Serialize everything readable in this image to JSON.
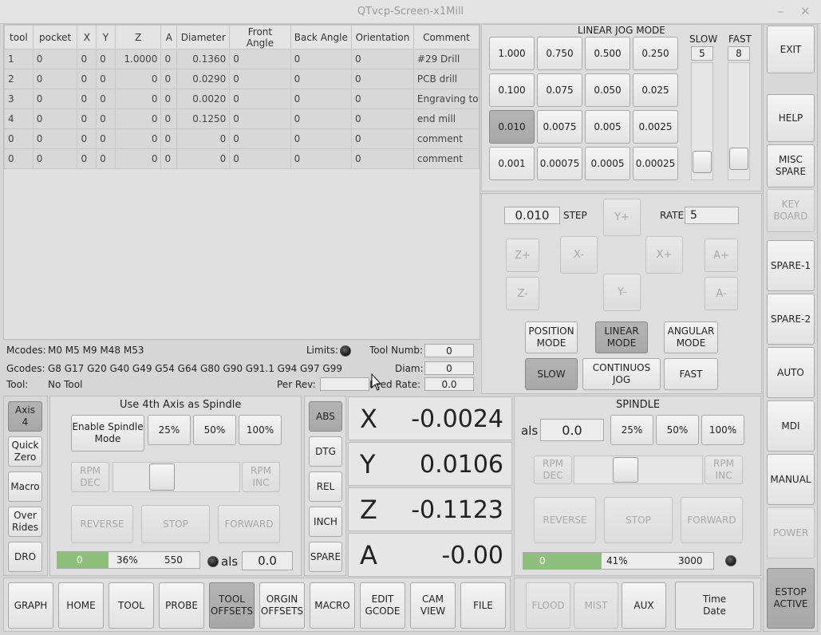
{
  "window": {
    "title": "QTvcp-Screen-x1Mill",
    "minimize": "–",
    "close": "✕"
  },
  "tool_table": {
    "headers": [
      "tool",
      "pocket",
      "X",
      "Y",
      "Z",
      "A",
      "Diameter",
      "Front Angle",
      "Back Angle",
      "Orientation",
      "Comment"
    ],
    "rows": [
      [
        "1",
        "0",
        "0",
        "0",
        "1.0000",
        "0",
        "0.1360",
        "0",
        "0",
        "0",
        "#29 Drill"
      ],
      [
        "2",
        "0",
        "0",
        "0",
        "0",
        "0",
        "0.0290",
        "0",
        "0",
        "0",
        "PCB drill"
      ],
      [
        "3",
        "0",
        "0",
        "0",
        "0",
        "0",
        "0.0020",
        "0",
        "0",
        "0",
        "Engraving tool"
      ],
      [
        "4",
        "0",
        "0",
        "0",
        "0",
        "0",
        "0.1250",
        "0",
        "0",
        "0",
        "end mill"
      ],
      [
        "0",
        "0",
        "0",
        "0",
        "0",
        "0",
        "0",
        "0",
        "0",
        "0",
        "comment"
      ],
      [
        "0",
        "0",
        "0",
        "0",
        "0",
        "0",
        "0",
        "0",
        "0",
        "0",
        "comment"
      ]
    ]
  },
  "status": {
    "mcodes_label": "Mcodes:",
    "mcodes": "M0 M5 M9 M48 M53",
    "gcodes_label": "Gcodes:",
    "gcodes": "G8 G17 G20 G40 G49 G54 G64 G80 G90 G91.1 G94 G97 G99",
    "tool_label": "Tool:",
    "tool": "No Tool",
    "limits_label": "Limits:",
    "tool_numb_label": "Tool Numb:",
    "tool_numb": "0",
    "diam_label": "Diam:",
    "diam": "0",
    "per_rev_label": "Per Rev:",
    "per_rev": "",
    "feed_rate_label": "Feed Rate:",
    "feed_rate": "0.0"
  },
  "jog": {
    "title": "LINEAR  JOG  MODE",
    "increments": [
      "1.000",
      "0.750",
      "0.500",
      "0.250",
      "0.100",
      "0.075",
      "0.050",
      "0.025",
      "0.010",
      "0.0075",
      "0.005",
      "0.0025",
      "0.001",
      "0.00075",
      "0.0005",
      "0.00025"
    ],
    "selected_increment": "0.010",
    "slow_label": "SLOW",
    "slow_value": "5",
    "fast_label": "FAST",
    "fast_value": "8",
    "step_value": "0.010",
    "step_label": "STEP",
    "rate_label": "RATE",
    "rate_value": "5",
    "buttons": {
      "y_plus": "Y+",
      "y_minus": "Y-",
      "x_plus": "X+",
      "x_minus": "X-",
      "z_plus": "Z+",
      "z_minus": "Z-",
      "a_plus": "A+",
      "a_minus": "A-"
    },
    "position_mode": "POSITION\nMODE",
    "linear_mode": "LINEAR\nMODE",
    "angular_mode": "ANGULAR\nMODE",
    "slow": "SLOW",
    "continuous": "CONTINUOS\nJOG",
    "fast": "FAST"
  },
  "right_nav": {
    "exit": "EXIT",
    "help": "HELP",
    "misc_spare": "MISC\nSPARE",
    "keyboard": "KEY\nBOARD",
    "spare1": "SPARE-1",
    "spare2": "SPARE-2",
    "auto": "AUTO",
    "mdi": "MDI",
    "manual": "MANUAL",
    "power": "POWER",
    "estop": "ESTOP\nACTIVE"
  },
  "left_tabs": [
    "Axis\n4",
    "Quick\nZero",
    "Macro",
    "Over\nRides",
    "DRO"
  ],
  "fourth_axis": {
    "title": "Use 4th Axis as Spindle",
    "enable": "Enable Spindle\nMode",
    "p25": "25%",
    "p50": "50%",
    "p100": "100%",
    "rpm_dec": "RPM\nDEC",
    "rpm_inc": "RPM\nINC",
    "reverse": "REVERSE",
    "stop": "STOP",
    "forward": "FORWARD",
    "bar_value": "0",
    "bar_pct": "36%",
    "bar_max": "550",
    "bar_fraction": 0.36,
    "als_label": "als",
    "als_value": "0.0"
  },
  "dro_modes": [
    "ABS",
    "DTG",
    "REL",
    "INCH",
    "SPARE"
  ],
  "dro": [
    {
      "axis": "X",
      "value": "-0.0024"
    },
    {
      "axis": "Y",
      "value": "0.0106"
    },
    {
      "axis": "Z",
      "value": "-0.1123"
    },
    {
      "axis": "A",
      "value": "-0.00"
    }
  ],
  "spindle": {
    "title": "SPINDLE",
    "als_label": "als",
    "als_value": "0.0",
    "p25": "25%",
    "p50": "50%",
    "p100": "100%",
    "rpm_dec": "RPM\nDEC",
    "rpm_inc": "RPM\nINC",
    "reverse": "REVERSE",
    "stop": "STOP",
    "forward": "FORWARD",
    "bar_value": "0",
    "bar_pct": "41%",
    "bar_max": "3000",
    "bar_fraction": 0.41
  },
  "bottom_tabs": [
    "GRAPH",
    "HOME",
    "TOOL",
    "PROBE",
    "TOOL\nOFFSETS",
    "ORGIN\nOFFSETS",
    "MACRO",
    "EDIT\nGCODE",
    "CAM\nVIEW",
    "FILE"
  ],
  "coolant": {
    "flood": "FLOOD",
    "mist": "MIST",
    "aux": "AUX",
    "time_date": "Time\nDate"
  }
}
